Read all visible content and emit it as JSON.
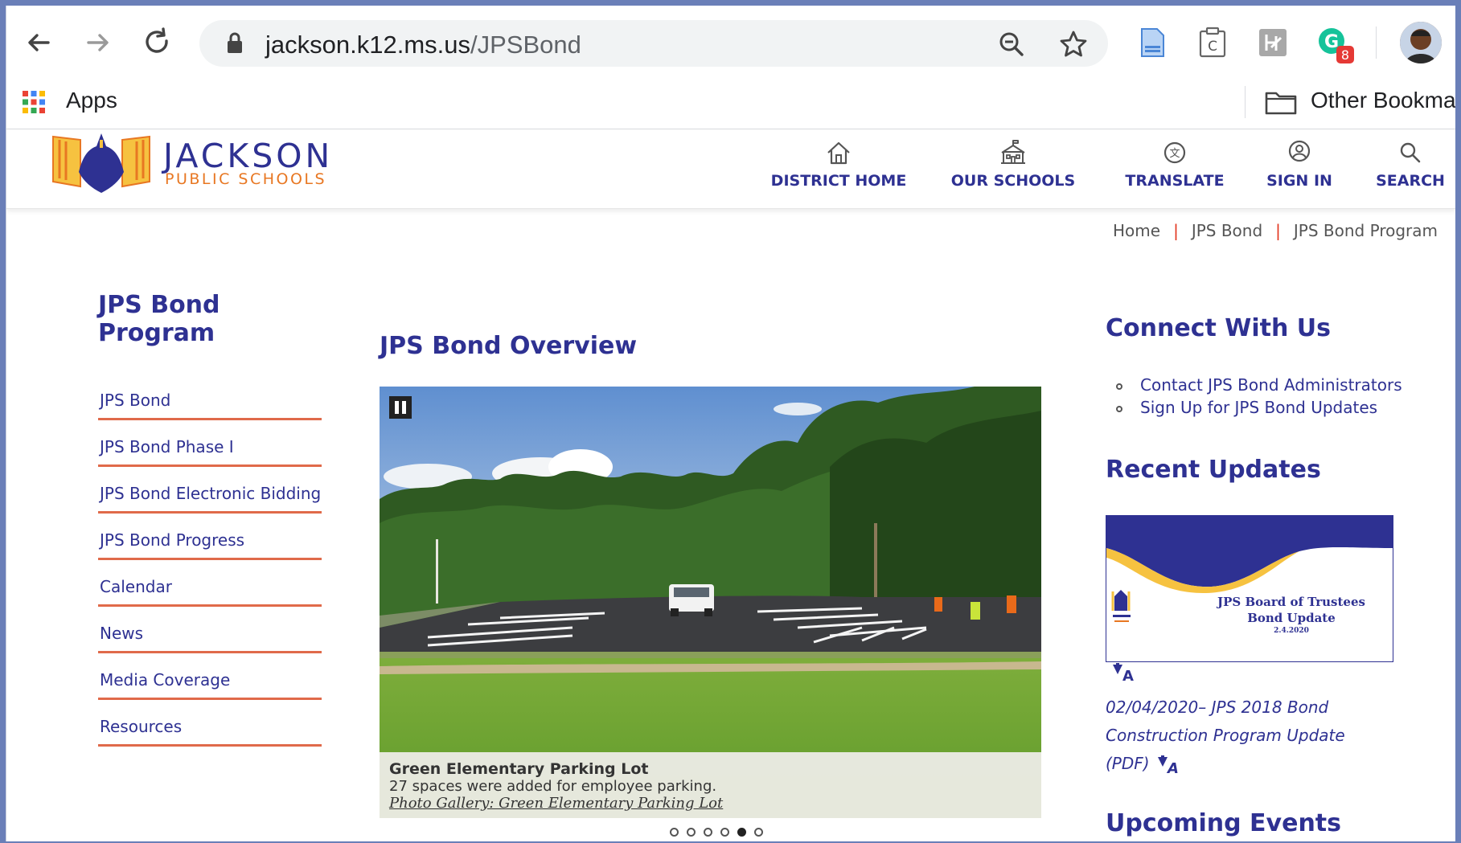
{
  "browser": {
    "url_host": "jackson.k12.ms.us",
    "url_path": "/JPSBond",
    "extensions": [
      {
        "name": "docs-extension-icon"
      },
      {
        "name": "clipboard-extension-icon",
        "letter": "C"
      },
      {
        "name": "translate-extension-icon"
      },
      {
        "name": "grammarly-extension-icon",
        "badge": "8"
      }
    ]
  },
  "bookmarks_bar": {
    "apps_label": "Apps",
    "other_label": "Other Bookma"
  },
  "site": {
    "brand_title": "JACKSON",
    "brand_subtitle": "PUBLIC SCHOOLS",
    "nav": [
      {
        "label": "DISTRICT HOME",
        "icon": "home-icon"
      },
      {
        "label": "OUR SCHOOLS",
        "icon": "school-icon"
      },
      {
        "label": "TRANSLATE",
        "icon": "translate-icon"
      },
      {
        "label": "SIGN IN",
        "icon": "user-icon"
      },
      {
        "label": "SEARCH",
        "icon": "search-icon"
      }
    ]
  },
  "breadcrumb": {
    "items": [
      "Home",
      "JPS Bond",
      "JPS Bond Program"
    ],
    "separator": "|"
  },
  "left_nav": {
    "title": "JPS Bond Program",
    "items": [
      "JPS Bond",
      "JPS Bond Phase I",
      "JPS Bond Electronic Bidding",
      "JPS Bond Progress",
      "Calendar",
      "News",
      "Media Coverage",
      "Resources"
    ]
  },
  "main": {
    "title": "JPS Bond Overview",
    "slide": {
      "caption_title": "Green Elementary Parking Lot",
      "caption_desc": "27 spaces were added for employee parking.",
      "caption_link": "Photo Gallery: Green Elementary Parking Lot"
    },
    "slide_count": 6,
    "active_slide": 5
  },
  "right": {
    "connect_title": "Connect With Us",
    "connect_links": [
      "Contact JPS Bond Administrators",
      "Sign Up for JPS Bond Updates"
    ],
    "updates_title": "Recent Updates",
    "update_thumb_title": "JPS Board of Trustees",
    "update_thumb_sub": "Bond Update",
    "update_thumb_date": "2.4.2020",
    "update_text": "02/04/2020– JPS 2018 Bond Construction Program Update (PDF)",
    "events_title": "Upcoming Events"
  },
  "colors": {
    "brand_blue": "#2e3192",
    "brand_orange": "#e87722",
    "divider_red": "#e06a4a",
    "frame_blue": "#6a7fb8"
  }
}
